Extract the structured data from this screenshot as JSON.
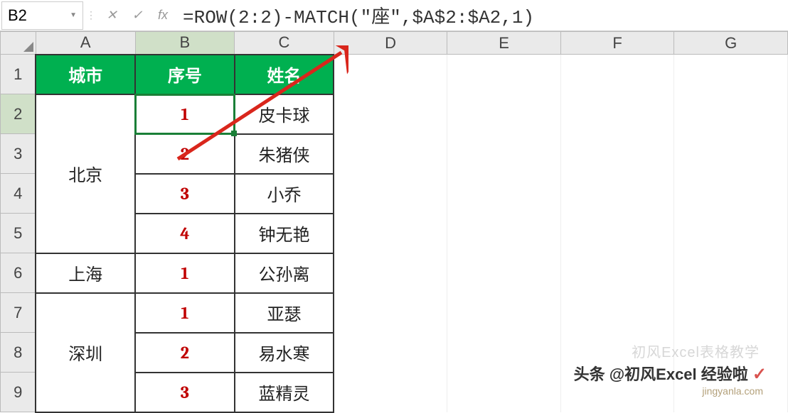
{
  "nameBox": {
    "value": "B2"
  },
  "formulaBar": {
    "formula": "=ROW(2:2)-MATCH(\"座\",$A$2:$A2,1)"
  },
  "columns": [
    "A",
    "B",
    "C",
    "D",
    "E",
    "F",
    "G"
  ],
  "rows": [
    "1",
    "2",
    "3",
    "4",
    "5",
    "6",
    "7",
    "8",
    "9"
  ],
  "headers": {
    "city": "城市",
    "seq": "序号",
    "name": "姓名"
  },
  "data": [
    {
      "city": "北京",
      "seq": "1",
      "name": "皮卡球"
    },
    {
      "city": "",
      "seq": "2",
      "name": "朱猪侠"
    },
    {
      "city": "",
      "seq": "3",
      "name": "小乔"
    },
    {
      "city": "",
      "seq": "4",
      "name": "钟无艳"
    },
    {
      "city": "上海",
      "seq": "1",
      "name": "公孙离"
    },
    {
      "city": "深圳",
      "seq": "1",
      "name": "亚瑟"
    },
    {
      "city": "",
      "seq": "2",
      "name": "易水寒"
    },
    {
      "city": "",
      "seq": "3",
      "name": "蓝精灵"
    }
  ],
  "watermark": {
    "line1": "初风Excel表格教学",
    "line2_prefix": "头条 @",
    "line2_text": "初风Excel 经验啦",
    "line3": "jingyanla.com"
  }
}
